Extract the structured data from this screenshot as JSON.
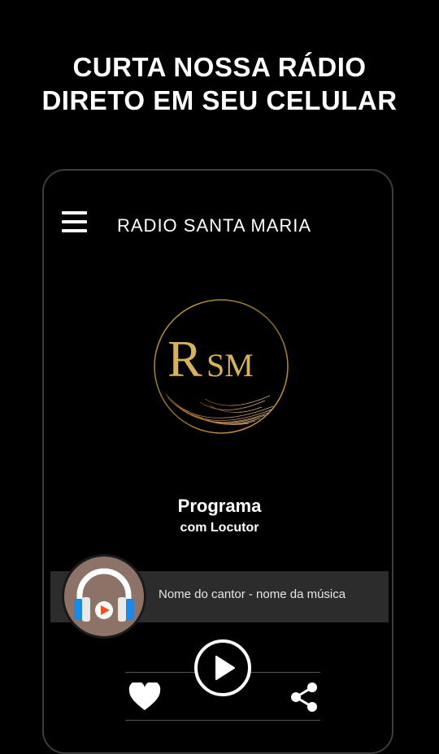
{
  "promo": {
    "line1": "CURTA NOSSA RÁDIO",
    "line2": "DIRETO EM SEU CELULAR"
  },
  "app": {
    "title": "RADIO SANTA MARIA",
    "logo_text": "RSM",
    "program": "Programa",
    "host": "com Locutor",
    "now_playing": "Nome do cantor - nome da música"
  },
  "icons": {
    "menu": "menu-icon",
    "play": "play-icon",
    "favorite": "heart-icon",
    "share": "share-icon",
    "headphones": "headphones-icon"
  },
  "colors": {
    "background": "#000000",
    "gold": "#d6b25a",
    "now_playing_bar": "#2c2c2c",
    "avatar_bg": "#8d7268",
    "accent_blue": "#1e88e5",
    "accent_orange": "#f4511e"
  }
}
